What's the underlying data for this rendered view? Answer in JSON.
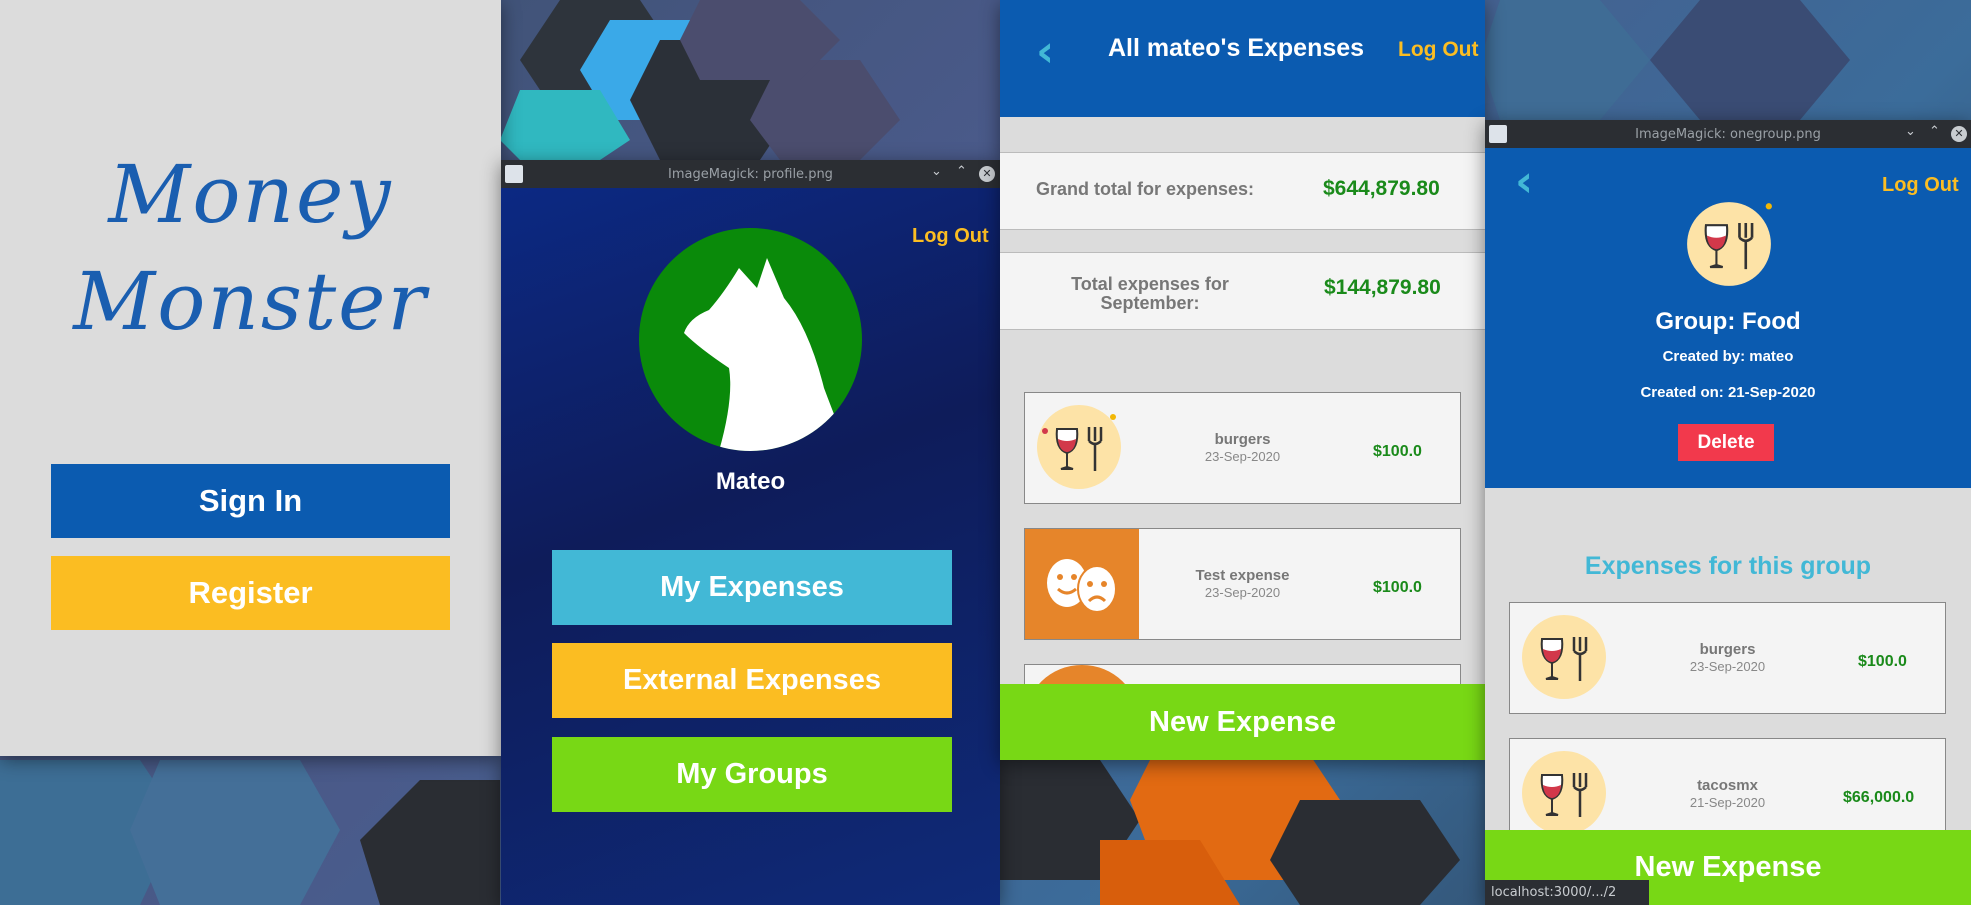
{
  "login": {
    "logo_line1": "Money",
    "logo_line2": "Monster",
    "sign_in": "Sign In",
    "register": "Register"
  },
  "profile_window": {
    "title": "ImageMagick: profile.png",
    "logout": "Log Out",
    "username": "Mateo",
    "my_expenses": "My Expenses",
    "external_expenses": "External Expenses",
    "my_groups": "My Groups"
  },
  "expenses_window": {
    "header_title": "All mateo's Expenses",
    "logout": "Log Out",
    "grand_total_label": "Grand total for expenses:",
    "grand_total_value": "$644,879.80",
    "month_total_label": "Total expenses for September:",
    "month_total_value": "$144,879.80",
    "items": [
      {
        "name": "burgers",
        "date": "23-Sep-2020",
        "amount": "$100.0",
        "icon": "food-icon"
      },
      {
        "name": "Test expense",
        "date": "23-Sep-2020",
        "amount": "$100.0",
        "icon": "theater-masks-icon"
      }
    ],
    "new_expense": "New Expense"
  },
  "group_window": {
    "title": "ImageMagick: onegroup.png",
    "logout": "Log Out",
    "group_name": "Group: Food",
    "created_by": "Created by: mateo",
    "created_on": "Created on: 21-Sep-2020",
    "delete": "Delete",
    "section_title": "Expenses for this group",
    "items": [
      {
        "name": "burgers",
        "date": "23-Sep-2020",
        "amount": "$100.0"
      },
      {
        "name": "tacosmx",
        "date": "21-Sep-2020",
        "amount": "$66,000.0"
      }
    ],
    "new_expense": "New Expense"
  },
  "status_bar": "localhost:3000/.../2",
  "colors": {
    "blue": "#0b5bb0",
    "yellow": "#fbbd22",
    "green": "#78d815",
    "teal": "#42b8d6",
    "red": "#f2394c",
    "money_green": "#1a8a1a",
    "profile_green": "#0a8a0a"
  }
}
